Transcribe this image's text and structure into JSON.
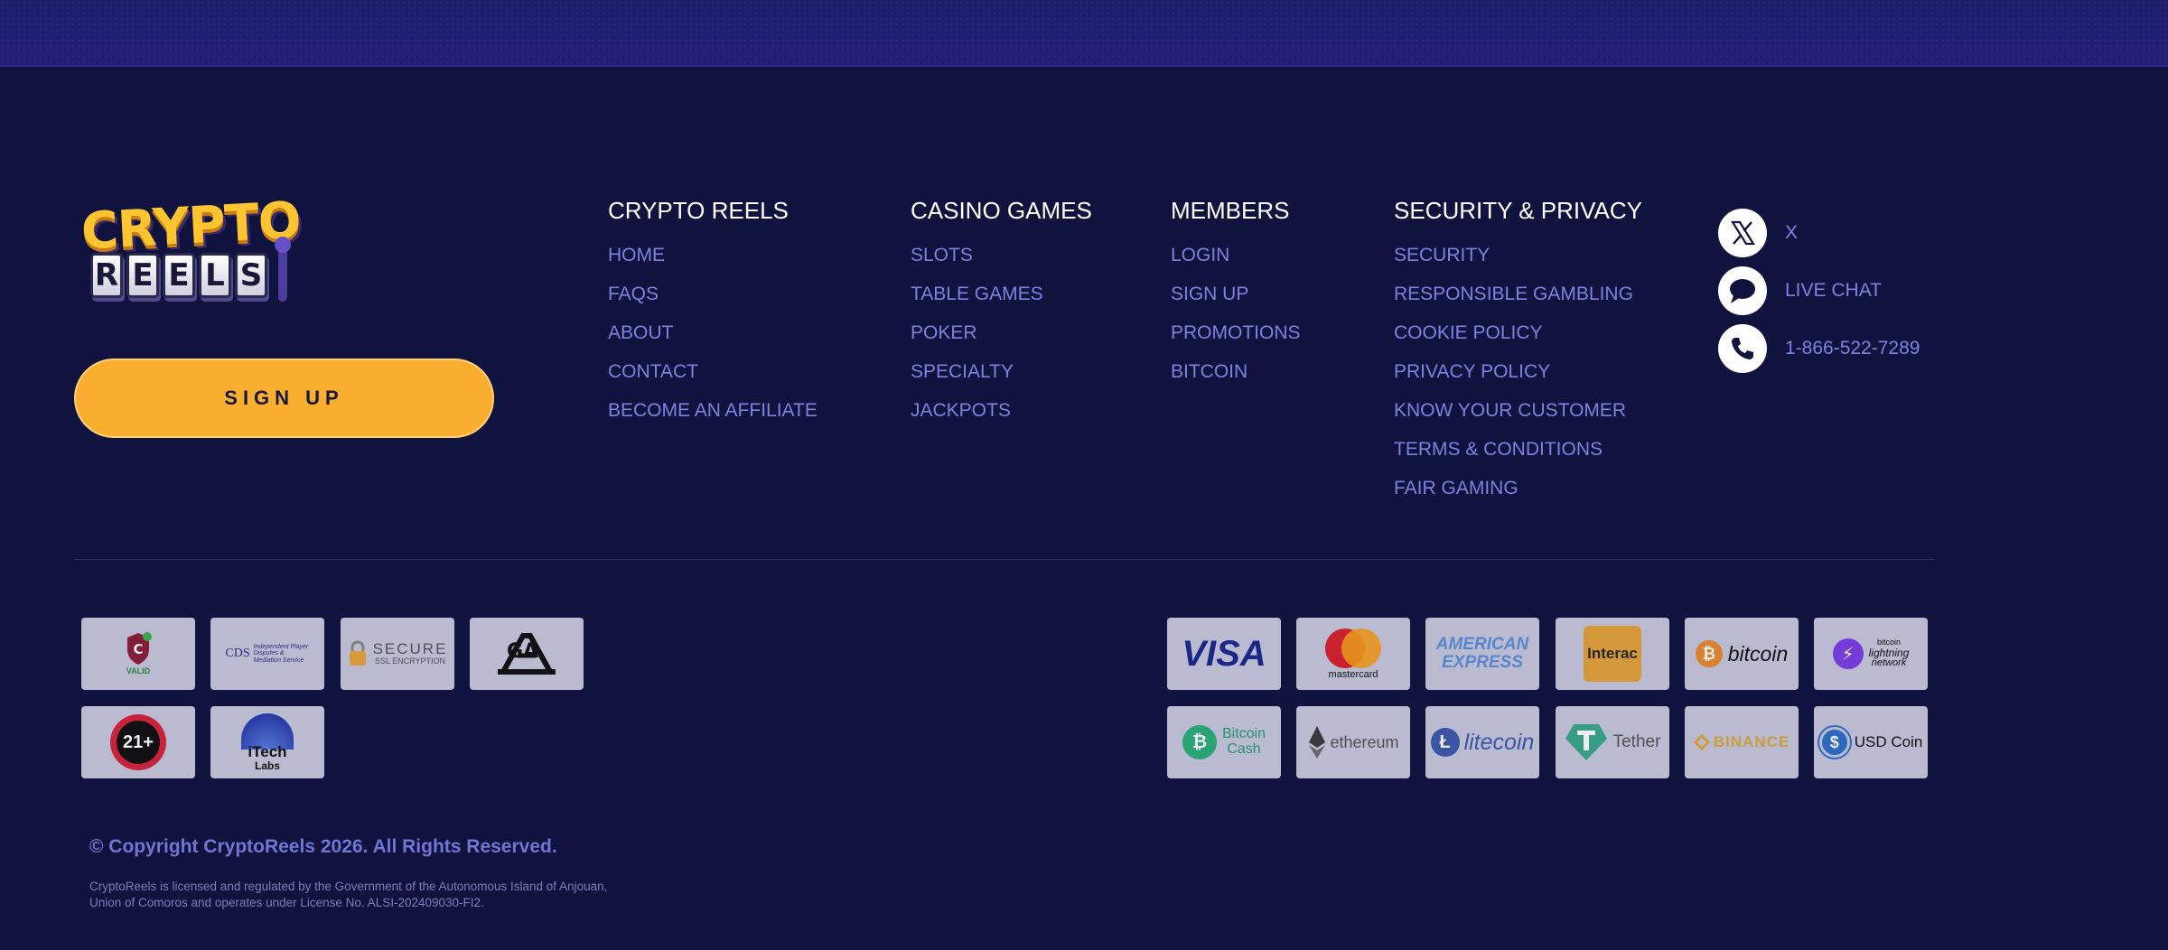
{
  "brand": {
    "logo_top": "CRYPTO",
    "logo_bottom": [
      "R",
      "E",
      "E",
      "L",
      "S"
    ],
    "logo_text": "Crypto Reels"
  },
  "signup_label": "SIGN UP",
  "columns": [
    {
      "title": "CRYPTO REELS",
      "links": [
        "HOME",
        "FAQS",
        "ABOUT",
        "CONTACT",
        "BECOME AN AFFILIATE"
      ]
    },
    {
      "title": "CASINO GAMES",
      "links": [
        "SLOTS",
        "TABLE GAMES",
        "POKER",
        "SPECIALTY",
        "JACKPOTS"
      ]
    },
    {
      "title": "MEMBERS",
      "links": [
        "LOGIN",
        "SIGN UP",
        "PROMOTIONS",
        "BITCOIN"
      ]
    },
    {
      "title": "SECURITY & PRIVACY",
      "links": [
        "SECURITY",
        "RESPONSIBLE GAMBLING",
        "COOKIE POLICY",
        "PRIVACY POLICY",
        "KNOW YOUR CUSTOMER",
        "TERMS & CONDITIONS",
        "FAIR GAMING"
      ]
    }
  ],
  "social": [
    {
      "icon": "x-icon",
      "label": "X"
    },
    {
      "icon": "chat-bubble-icon",
      "label": "LIVE CHAT"
    },
    {
      "icon": "phone-icon",
      "label": "1-866-522-7289"
    }
  ],
  "trust_badges": {
    "valid": "VALID",
    "cds": "CDS",
    "cds_sub": "Independent Player Disputes & Mediation Service",
    "secure": "SECURE",
    "secure_sub": "SSL ENCRYPTION",
    "ga": "GA",
    "age": "21+",
    "itech": "iTech",
    "itech_sub": "Labs"
  },
  "payments": {
    "visa": "VISA",
    "mastercard": "mastercard",
    "amex_line1": "AMERICAN",
    "amex_line2": "EXPRESS",
    "interac": "Interac",
    "bitcoin": "bitcoin",
    "lightning_line1": "bitcoin",
    "lightning_line2": "lightning",
    "lightning_line3": "network",
    "bitcoin_cash_line1": "Bitcoin",
    "bitcoin_cash_line2": "Cash",
    "ethereum": "ethereum",
    "litecoin": "litecoin",
    "tether": "Tether",
    "binance": "BINANCE",
    "usd_coin": "USD Coin"
  },
  "colors": {
    "background": "#11133f",
    "accent": "#f9ae2f",
    "link": "#7e82df"
  },
  "copyright": "© Copyright CryptoReels 2026. All Rights Reserved.",
  "license": "CryptoReels is licensed and regulated by the Government of the Autonomous Island of Anjouan, Union of Comoros and operates under License No. ALSI-202409030-FI2."
}
